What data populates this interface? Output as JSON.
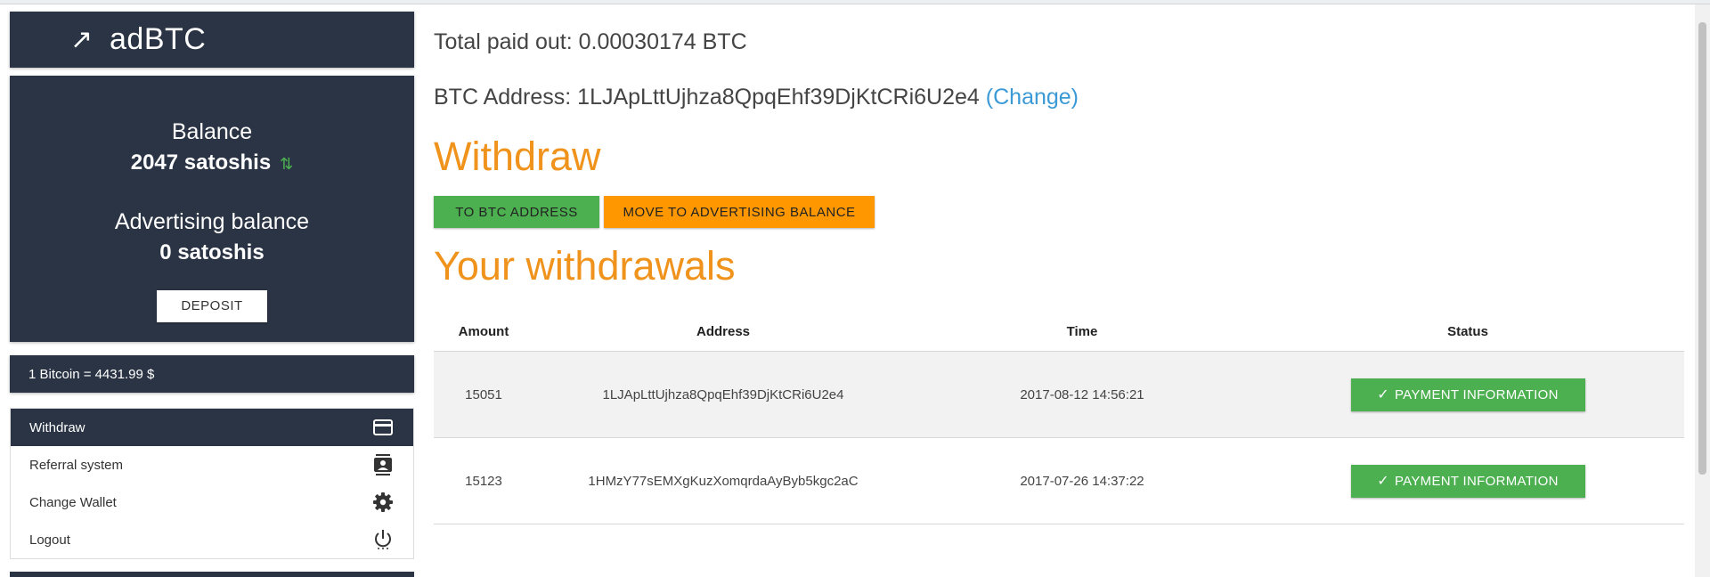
{
  "sidebar": {
    "brand_arrow": "↗",
    "brand_name": "adBTC",
    "balance_label": "Balance",
    "balance_value": "2047 satoshis",
    "balance_swap_icon": "⇅",
    "adv_label": "Advertising balance",
    "adv_value": "0 satoshis",
    "deposit_label": "DEPOSIT",
    "rate": "1 Bitcoin = 4431.99 $",
    "menu": [
      {
        "label": "Withdraw",
        "icon": "credit-card-icon"
      },
      {
        "label": "Referral system",
        "icon": "contacts-icon"
      },
      {
        "label": "Change Wallet",
        "icon": "gear-icon"
      },
      {
        "label": "Logout",
        "icon": "power-icon"
      }
    ]
  },
  "main": {
    "total_paid": "Total paid out: 0.00030174 BTC",
    "btc_address_label": "BTC Address: 1LJApLttUjhza8QpqEhf39DjKtCRi6U2e4",
    "change_link": "(Change)",
    "withdraw_heading": "Withdraw",
    "btn_to_btc": "TO BTC ADDRESS",
    "btn_move_adv": "MOVE TO ADVERTISING BALANCE",
    "withdrawals_heading": "Your withdrawals",
    "table": {
      "headers": [
        "Amount",
        "Address",
        "Time",
        "Status"
      ],
      "rows": [
        {
          "amount": "15051",
          "address": "1LJApLttUjhza8QpqEhf39DjKtCRi6U2e4",
          "time": "2017-08-12 14:56:21",
          "status": "PAYMENT INFORMATION"
        },
        {
          "amount": "15123",
          "address": "1HMzY77sEMXgKuzXomqrdaAyByb5kgc2aC",
          "time": "2017-07-26 14:37:22",
          "status": "PAYMENT INFORMATION"
        }
      ]
    }
  },
  "colors": {
    "sidebar_bg": "#2b3444",
    "accent_orange": "#f0931c",
    "button_green": "#4caf50",
    "button_orange": "#ff9800",
    "link_blue": "#3b9ad6"
  }
}
